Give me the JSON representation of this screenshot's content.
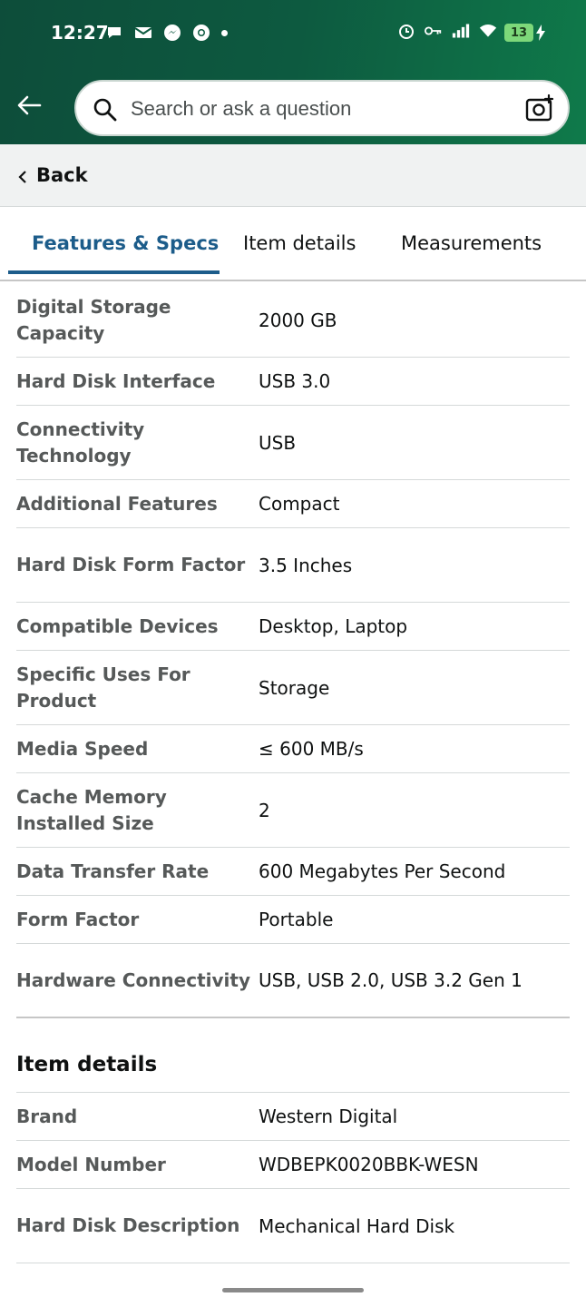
{
  "status_bar": {
    "time": "12:27",
    "battery": "13"
  },
  "search": {
    "placeholder": "Search or ask a question"
  },
  "nav": {
    "back_label": "Back"
  },
  "tabs": [
    {
      "label": "Features & Specs",
      "active": true
    },
    {
      "label": "Item details",
      "active": false
    },
    {
      "label": "Measurements",
      "active": false
    }
  ],
  "specs": [
    {
      "key": "Digital Storage Capacity",
      "value": "2000 GB"
    },
    {
      "key": "Hard Disk Interface",
      "value": "USB 3.0"
    },
    {
      "key": "Connectivity Technology",
      "value": "USB"
    },
    {
      "key": "Additional Features",
      "value": "Compact"
    },
    {
      "key": "Hard Disk Form Factor",
      "value": "3.5 Inches"
    },
    {
      "key": "Compatible Devices",
      "value": "Desktop, Laptop"
    },
    {
      "key": "Specific Uses For Product",
      "value": "Storage"
    },
    {
      "key": "Media Speed",
      "value": "≤ 600 MB/s"
    },
    {
      "key": "Cache Memory Installed Size",
      "value": "2"
    },
    {
      "key": "Data Transfer Rate",
      "value": "600 Megabytes Per Second"
    },
    {
      "key": "Form Factor",
      "value": "Portable"
    },
    {
      "key": "Hardware Connectivity",
      "value": "USB, USB 2.0, USB 3.2 Gen 1"
    }
  ],
  "item_details": {
    "title": "Item details",
    "rows": [
      {
        "key": "Brand",
        "value": "Western Digital"
      },
      {
        "key": "Model Number",
        "value": "WDBEPK0020BBK-WESN"
      },
      {
        "key": "Hard Disk Description",
        "value": "Mechanical Hard Disk"
      }
    ]
  },
  "colors": {
    "header_gradient_start": "#0d4d3a",
    "header_gradient_end": "#0f7a4a",
    "active_tab": "#1c5c8a"
  }
}
